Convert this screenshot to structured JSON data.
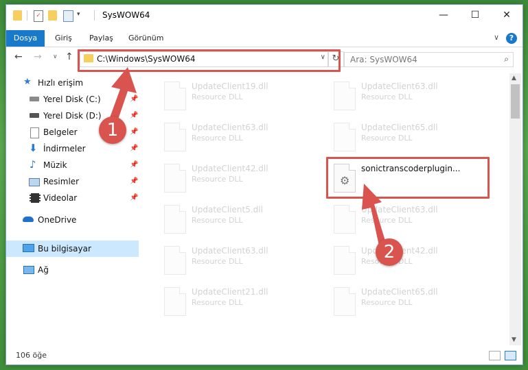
{
  "window": {
    "title": "SysWOW64"
  },
  "title_controls": {
    "minimize": "—",
    "maximize": "☐",
    "close": "✕"
  },
  "ribbon": {
    "tabs": [
      {
        "label": "Dosya",
        "active": true
      },
      {
        "label": "Giriş"
      },
      {
        "label": "Paylaş"
      },
      {
        "label": "Görünüm"
      }
    ],
    "help": "?",
    "collapse": "∨"
  },
  "nav": {
    "back": "←",
    "forward": "→",
    "recent": "∨",
    "up": "↑",
    "address": "C:\\Windows\\SysWOW64",
    "address_dropdown": "∨",
    "refresh": "↻",
    "search_placeholder": "Ara: SysWOW64",
    "search_glyph": "⌕"
  },
  "sidebar": {
    "items": [
      {
        "label": "Hızlı erişim",
        "icon": "star-icon"
      },
      {
        "label": "Yerel Disk (C:)",
        "icon": "drive-icon",
        "pinned": true
      },
      {
        "label": "Yerel Disk (D:)",
        "icon": "drive-icon",
        "pinned": true
      },
      {
        "label": "Belgeler",
        "icon": "documents-icon",
        "pinned": true
      },
      {
        "label": "İndirmeler",
        "icon": "download-icon",
        "pinned": true
      },
      {
        "label": "Müzik",
        "icon": "music-icon",
        "pinned": true
      },
      {
        "label": "Resimler",
        "icon": "pictures-icon",
        "pinned": true
      },
      {
        "label": "Videolar",
        "icon": "videos-icon",
        "pinned": true
      },
      {
        "label": "OneDrive",
        "icon": "onedrive-icon"
      },
      {
        "label": "Bu bilgisayar",
        "icon": "computer-icon",
        "selected": true
      },
      {
        "label": "Ağ",
        "icon": "network-icon"
      }
    ],
    "pin_glyph": "📌"
  },
  "files": [
    {
      "name": "UpdateClient19.dll",
      "type": "Resource DLL"
    },
    {
      "name": "UpdateClient63.dll",
      "type": "Resource DLL"
    },
    {
      "name": "UpdateClient63.dll",
      "type": "Resource DLL"
    },
    {
      "name": "UpdateClient65.dll",
      "type": "Resource DLL"
    },
    {
      "name": "UpdateClient42.dll",
      "type": "Resource DLL"
    },
    {
      "name": "sonictranscoderplugin...",
      "type": "",
      "highlighted": true
    },
    {
      "name": "UpdateClient5.dll",
      "type": "Resource DLL"
    },
    {
      "name": "UpdateClient63.dll",
      "type": "Resource DLL"
    },
    {
      "name": "UpdateClient63.dll",
      "type": "Resource DLL"
    },
    {
      "name": "UpdateClient42.dll",
      "type": "Resource DLL"
    },
    {
      "name": "UpdateClient21.dll",
      "type": "Resource DLL"
    },
    {
      "name": "UpdateClient65.dll",
      "type": "Resource DLL"
    }
  ],
  "status": {
    "count": "106 öğe"
  },
  "annotations": {
    "step1": "1",
    "step2": "2",
    "color": "#d9534f"
  },
  "scroll": {
    "up": "▲",
    "down": "▼"
  }
}
